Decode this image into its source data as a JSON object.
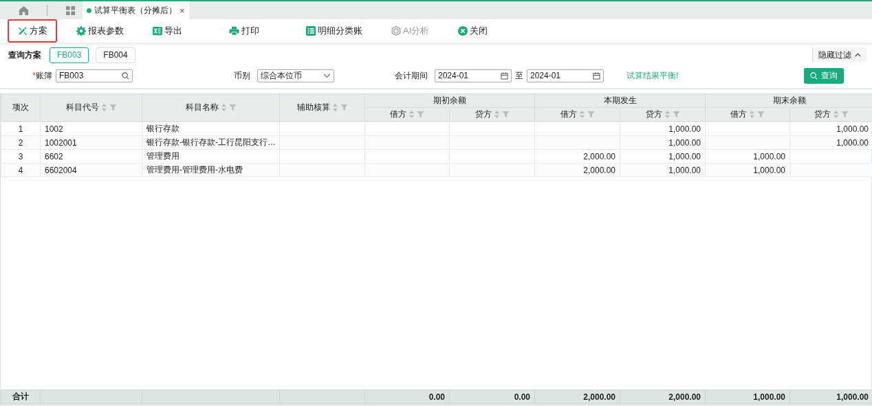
{
  "tab_bar": {
    "document_tab": {
      "title": "试算平衡表（分摊后）",
      "close": "×"
    }
  },
  "toolbar": [
    {
      "label": "方案",
      "kind": "scheme",
      "disabled": false,
      "highlighted": true
    },
    {
      "label": "报表参数",
      "kind": "settings",
      "disabled": false,
      "highlighted": false
    },
    {
      "label": "导出",
      "kind": "excel",
      "disabled": false,
      "highlighted": false
    },
    {
      "label": "打印",
      "kind": "print",
      "disabled": false,
      "highlighted": false
    },
    {
      "label": "明细分类账",
      "kind": "ledger",
      "disabled": false,
      "highlighted": false
    },
    {
      "label": "AI分析",
      "kind": "ai",
      "disabled": true,
      "highlighted": false
    },
    {
      "label": "关闭",
      "kind": "close",
      "disabled": false,
      "highlighted": false
    }
  ],
  "filters": {
    "scheme_label": "查询方案",
    "schemes": [
      {
        "label": "FB003",
        "selected": true
      },
      {
        "label": "FB004",
        "selected": false
      }
    ],
    "hide_filter": "隐藏过滤",
    "ledger": {
      "required_mark": "*",
      "label": "账簿",
      "value": "FB003"
    },
    "currency": {
      "label": "币别",
      "value": "综合本位币"
    },
    "period": {
      "label": "会计期间",
      "from": "2024-01",
      "separator": "至",
      "to": "2024-01"
    },
    "message": "试算结果平衡!",
    "query_button": "查询"
  },
  "table": {
    "columns": [
      {
        "label": "项次",
        "sortable": false
      },
      {
        "label": "科目代号",
        "sortable": true
      },
      {
        "label": "科目名称",
        "sortable": true
      },
      {
        "label": "辅助核算",
        "sortable": true
      },
      {
        "label": "期初余额",
        "colspan": 2,
        "children": [
          {
            "label": "借方",
            "sortable": true
          },
          {
            "label": "贷方",
            "sortable": true
          }
        ]
      },
      {
        "label": "本期发生",
        "colspan": 2,
        "children": [
          {
            "label": "借方",
            "sortable": true
          },
          {
            "label": "贷方",
            "sortable": true
          }
        ]
      },
      {
        "label": "期末余额",
        "colspan": 2,
        "children": [
          {
            "label": "借方",
            "sortable": true
          },
          {
            "label": "贷方",
            "sortable": true
          }
        ]
      }
    ],
    "rows": [
      {
        "cells": [
          "1",
          "1002",
          "银行存款",
          null,
          null,
          null,
          null,
          "1,000.00",
          null,
          "1,000.00"
        ]
      },
      {
        "cells": [
          "2",
          "1002001",
          "银行存款-银行存款-工行昆阳支行…",
          null,
          null,
          null,
          null,
          "1,000.00",
          null,
          "1,000.00"
        ]
      },
      {
        "cells": [
          "3",
          "6602",
          "管理费用",
          null,
          null,
          null,
          "2,000.00",
          "1,000.00",
          "1,000.00",
          null
        ]
      },
      {
        "cells": [
          "4",
          "6602004",
          "管理费用-管理费用-水电费",
          null,
          null,
          null,
          "2,000.00",
          "1,000.00",
          "1,000.00",
          null
        ]
      }
    ],
    "total": {
      "cells": [
        "合计",
        null,
        null,
        null,
        "0.00",
        "0.00",
        "2,000.00",
        "2,000.00",
        "1,000.00",
        "1,000.00"
      ]
    }
  }
}
